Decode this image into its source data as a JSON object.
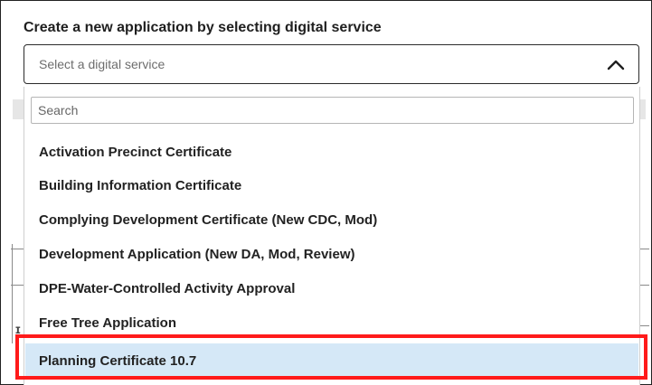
{
  "form": {
    "heading": "Create a new application by selecting digital service",
    "select": {
      "placeholder": "Select a digital service",
      "expanded": true,
      "icon": "chevron-up-icon"
    }
  },
  "dropdown": {
    "search_placeholder": "Search",
    "options": [
      "Activation Precinct Certificate",
      "Building Information Certificate",
      "Complying Development Certificate (New CDC, Mod)",
      "Development Application (New DA, Mod, Review)",
      "DPE-Water-Controlled Activity Approval",
      "Free Tree Application",
      "Planning Certificate 10.7"
    ],
    "selected_index": 6
  },
  "colors": {
    "selected_bg": "#d5e8f7",
    "highlight_border": "#ff1a1a",
    "text": "#222222"
  }
}
